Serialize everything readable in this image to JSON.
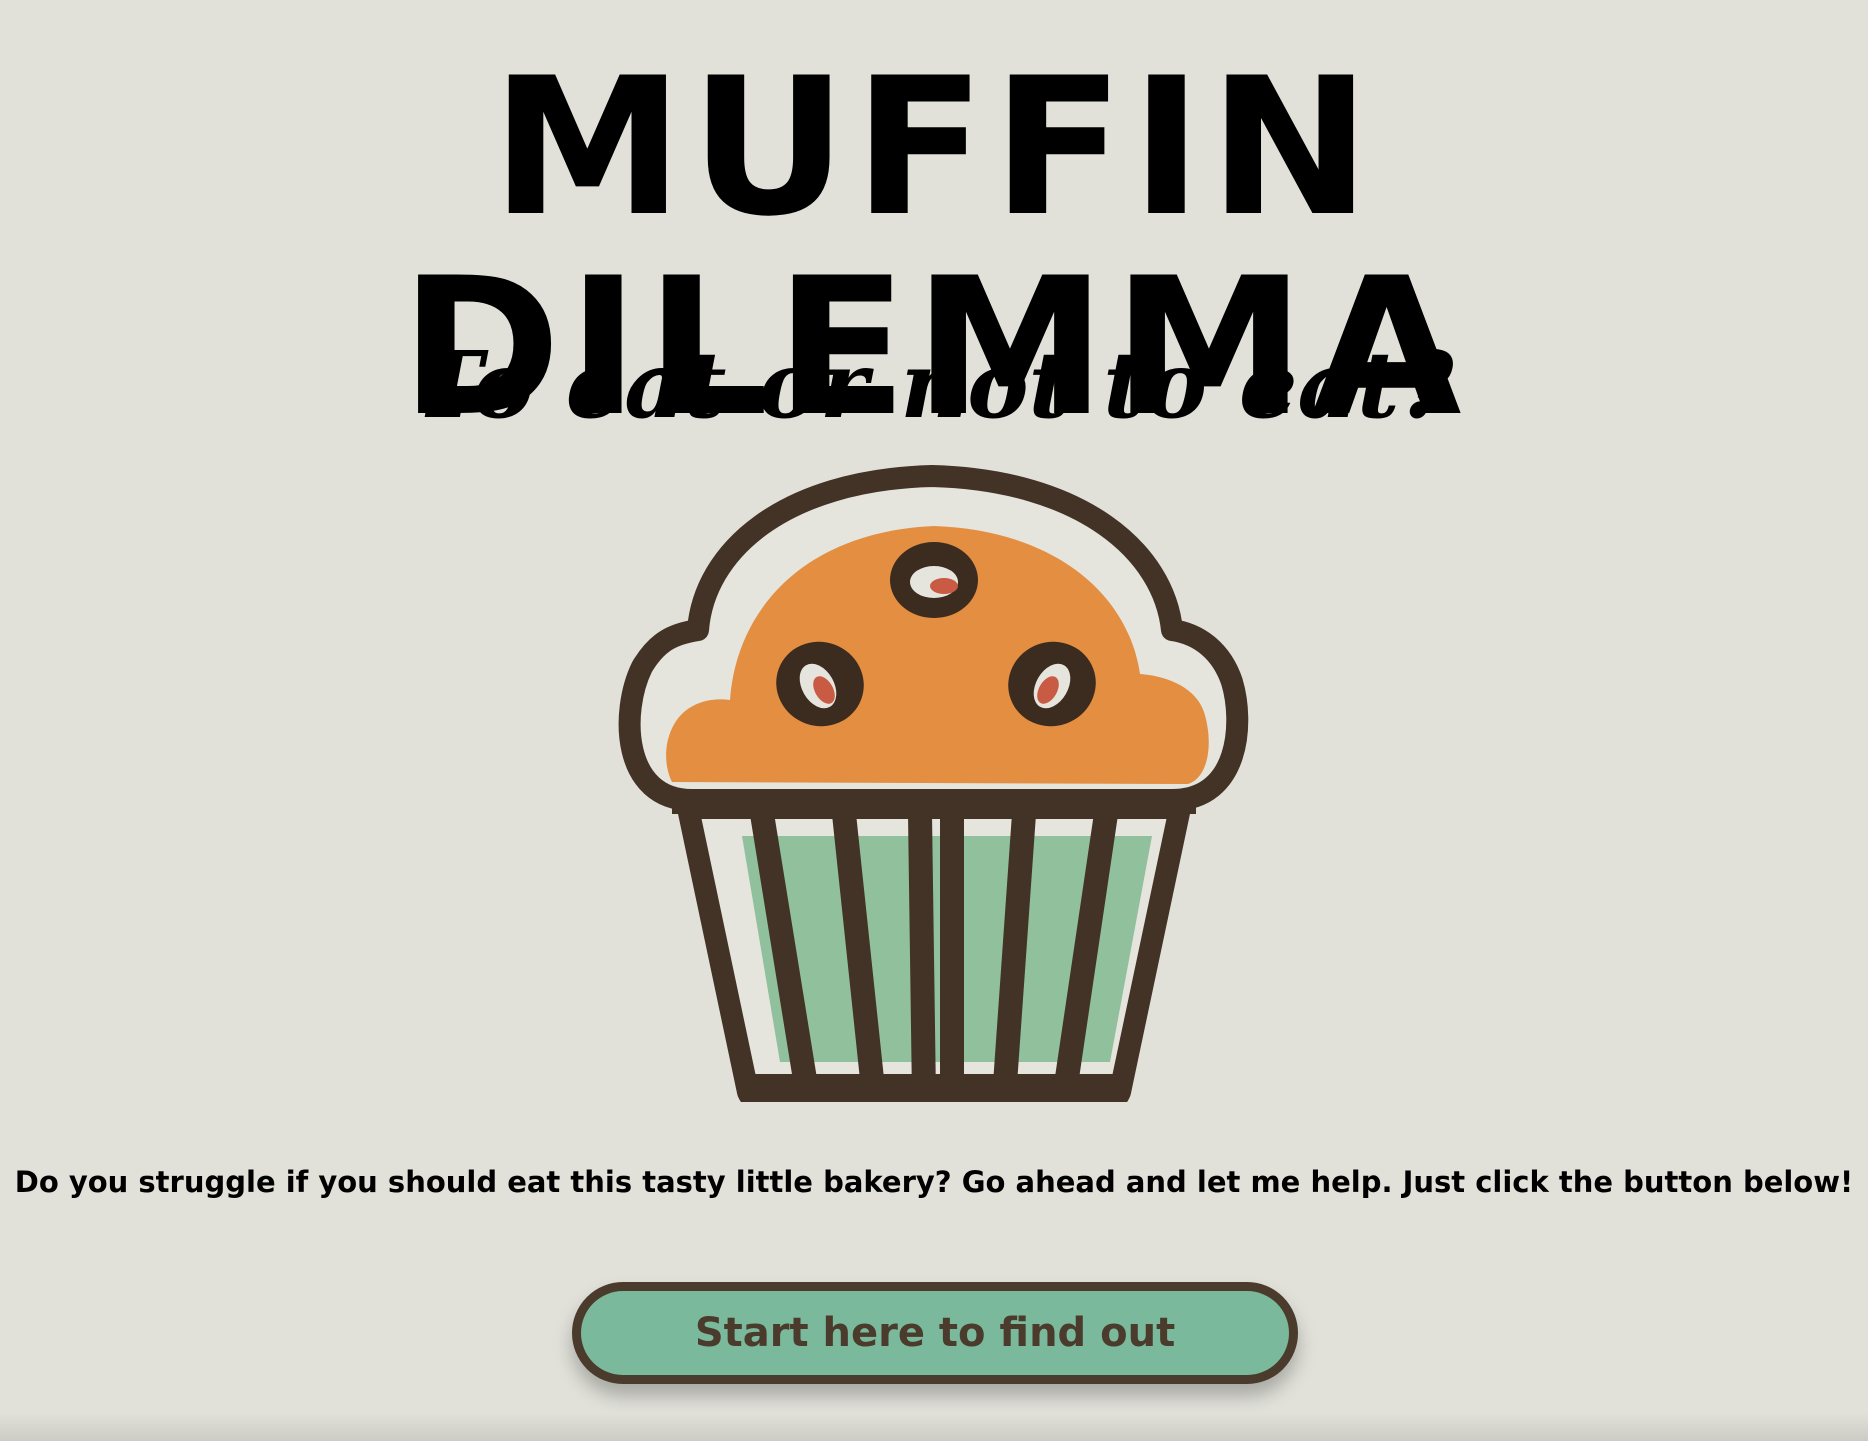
{
  "header": {
    "title": "MUFFIN DILEMMA",
    "tagline": "To eat or not to eat?"
  },
  "main": {
    "illustration_icon": "muffin-icon",
    "description": "Do you struggle if you should eat this tasty little bakery? Go ahead and let me help. Just click the button below!",
    "cta_label": "Start here to find out"
  },
  "colors": {
    "background": "#e1e1da",
    "accent_green": "#7ab99b",
    "accent_brown": "#4a3b2c",
    "muffin_top": "#e38e40",
    "muffin_liner": "#91c09d",
    "berry": "#c95b45"
  }
}
